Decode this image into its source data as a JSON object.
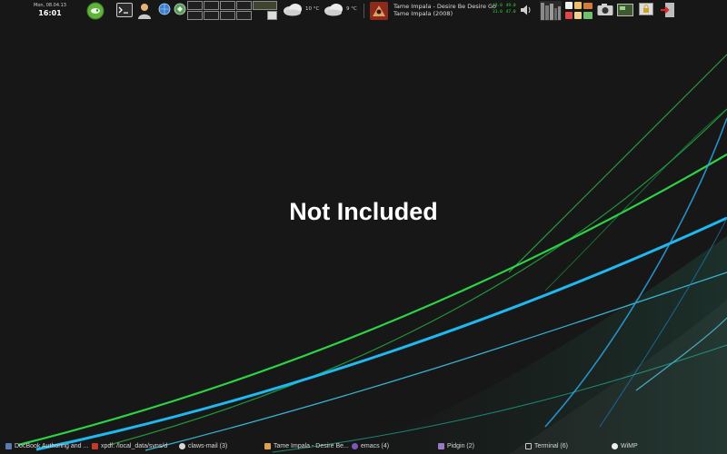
{
  "colors": {
    "background": "#171717",
    "accent_green": "#2ee84a",
    "accent_blue": "#1fb8f0",
    "meter_green": "#39d33a"
  },
  "top_panel": {
    "clock": {
      "date": "Mon, 08.04.13",
      "time": "16:01"
    },
    "launcher_icons": [
      "opensuse-logo-icon",
      "terminal-icon",
      "user-icon",
      "globe-icon",
      "desktop-pager-icon"
    ],
    "weather": [
      {
        "icon": "cloud-icon",
        "temp": "10 °C"
      },
      {
        "icon": "cloud-icon",
        "temp": "9 °C"
      }
    ],
    "now_playing": {
      "line1": "Tame Impala - Desire Be Desire Go",
      "line2": "Tame Impala (2008)"
    },
    "meter": {
      "row1": [
        "49.0",
        "49.0"
      ],
      "row2": [
        "31.0",
        "47.0"
      ]
    },
    "tray_icons": [
      "speaker-icon",
      "cpu-graph-icon",
      "notes-icon",
      "mail-icon",
      "camera-icon",
      "monitor-icon",
      "lock-icon",
      "logout-icon"
    ]
  },
  "center_text": "Not Included",
  "taskbar": {
    "tasks": [
      {
        "label": "DocBook Authoring and ...",
        "icon": "docbook-icon"
      },
      {
        "label": "xpdf: /local_data/svns/d",
        "icon": "xpdf-icon"
      },
      {
        "label": "claws-mail (3)",
        "icon": "claws-mail-icon"
      },
      {
        "label": "Tame Impala - Desire Be...",
        "icon": "music-player-icon"
      },
      {
        "label": "emacs (4)",
        "icon": "emacs-icon"
      },
      {
        "label": "Pidgin (2)",
        "icon": "pidgin-icon"
      },
      {
        "label": "Terminal (6)",
        "icon": "terminal-icon"
      },
      {
        "label": "WiMP",
        "icon": "wimp-icon"
      }
    ]
  }
}
